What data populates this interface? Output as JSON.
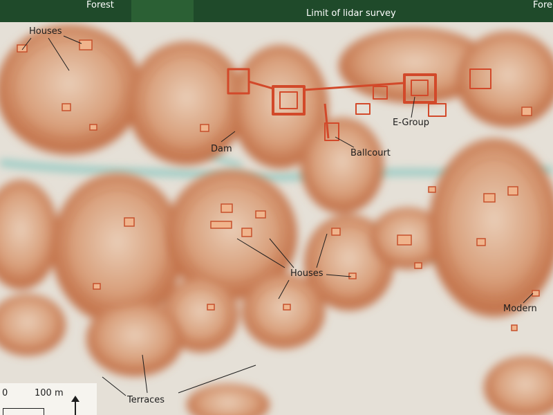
{
  "top_bar": {
    "forest_left": "Forest",
    "forest_right": "Fore",
    "survey_limit": "Limit of lidar survey"
  },
  "labels": {
    "houses_top": "Houses",
    "dam": "Dam",
    "ballcourt": "Ballcourt",
    "egroup": "E-Group",
    "houses_center": "Houses",
    "modern": "Modern",
    "terraces": "Terraces"
  },
  "scale_bar": {
    "zero": "0",
    "distance": "100 m"
  },
  "colors": {
    "forest": "#1f4a2a",
    "ground": "#e6e1d8",
    "relief": "#c9805a",
    "relief_dark": "#b0542e",
    "shadow": "#5bb5b0",
    "structures": "#d2492a"
  }
}
